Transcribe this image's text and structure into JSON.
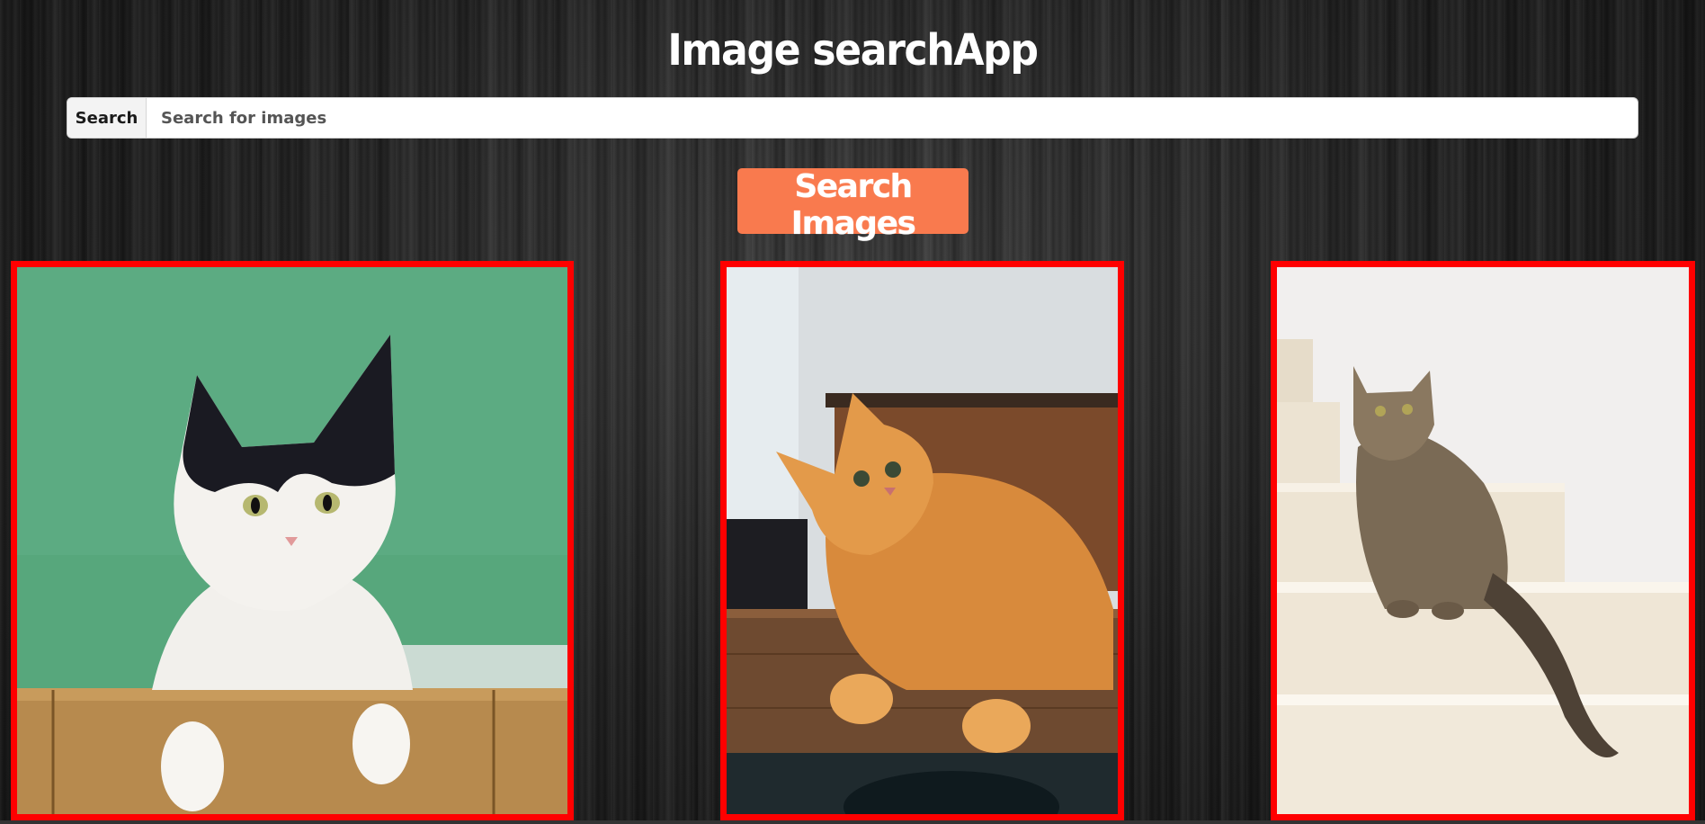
{
  "app": {
    "title": "Image searchApp"
  },
  "search": {
    "label": "Search",
    "placeholder": "Search for images",
    "value": ""
  },
  "actions": {
    "search_button_label": "Search Images"
  },
  "theme": {
    "accent": "#f97a4e",
    "card_border": "#ff0000",
    "title_color": "#ffffff"
  },
  "results": [
    {
      "icon": "cat-photo",
      "subject": "black-and-white cat on green background"
    },
    {
      "icon": "cat-photo",
      "subject": "orange tabby cat lying on a table"
    },
    {
      "icon": "cat-photo",
      "subject": "tabby cat sitting on white stairs"
    }
  ]
}
